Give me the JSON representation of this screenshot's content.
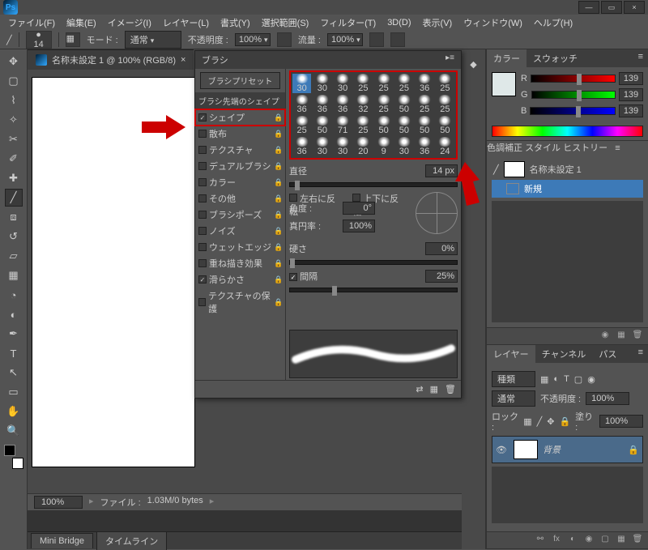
{
  "app": {
    "logo": "Ps"
  },
  "menu": [
    "ファイル(F)",
    "編集(E)",
    "イメージ(I)",
    "レイヤー(L)",
    "書式(Y)",
    "選択範囲(S)",
    "フィルター(T)",
    "3D(D)",
    "表示(V)",
    "ウィンドウ(W)",
    "ヘルプ(H)"
  ],
  "options": {
    "brush_size": "14",
    "mode_label": "モード :",
    "mode_value": "通常",
    "opacity_label": "不透明度 :",
    "opacity_value": "100%",
    "flow_label": "流量 :",
    "flow_value": "100%"
  },
  "document": {
    "tab": "名称未設定 1 @ 100% (RGB/8)",
    "close": "×"
  },
  "status": {
    "zoom": "100%",
    "info_label": "ファイル :",
    "info": "1.03M/0 bytes"
  },
  "bottom_tabs": [
    "Mini Bridge",
    "タイムライン"
  ],
  "color_panel": {
    "tab1": "カラー",
    "tab2": "スウォッチ",
    "r_label": "R",
    "r_value": "139",
    "g_label": "G",
    "g_value": "139",
    "b_label": "B",
    "b_value": "139"
  },
  "history_panel": {
    "tab1": "色調補正",
    "tab2": "スタイル",
    "tab3": "ヒストリー",
    "doc": "名称未設定 1",
    "item": "新規"
  },
  "layers_panel": {
    "tab1": "レイヤー",
    "tab2": "チャンネル",
    "tab3": "パス",
    "kind_label": "種類",
    "blend": "通常",
    "opacity_label": "不透明度 :",
    "opacity_value": "100%",
    "lock_label": "ロック :",
    "fill_label": "塗り :",
    "fill_value": "100%",
    "layer_name": "背景"
  },
  "brush_panel": {
    "title": "ブラシ",
    "preset_btn": "ブラシプリセット",
    "section": "ブラシ先端のシェイプ",
    "opts": [
      {
        "label": "シェイプ",
        "checked": true,
        "lock": true,
        "hilite": true
      },
      {
        "label": "散布",
        "checked": false,
        "lock": true
      },
      {
        "label": "テクスチャ",
        "checked": false,
        "lock": true
      },
      {
        "label": "デュアルブラシ",
        "checked": false,
        "lock": true
      },
      {
        "label": "カラー",
        "checked": false,
        "lock": true
      },
      {
        "label": "その他",
        "checked": false,
        "lock": true
      },
      {
        "label": "ブラシポーズ",
        "checked": false,
        "lock": true
      },
      {
        "label": "ノイズ",
        "checked": false,
        "lock": true
      },
      {
        "label": "ウェットエッジ",
        "checked": false,
        "lock": true
      },
      {
        "label": "重ね描き効果",
        "checked": false,
        "lock": true
      },
      {
        "label": "滑らかさ",
        "checked": true,
        "lock": true
      },
      {
        "label": "テクスチャの保護",
        "checked": false,
        "lock": true
      }
    ],
    "tips": [
      30,
      30,
      30,
      25,
      25,
      25,
      36,
      25,
      36,
      36,
      36,
      32,
      25,
      50,
      25,
      25,
      25,
      50,
      71,
      25,
      50,
      50,
      50,
      50,
      36,
      30,
      30,
      20,
      9,
      30,
      36,
      24
    ],
    "size_label": "直径",
    "size_value": "14 px",
    "flipx": "左右に反転",
    "flipy": "上下に反転",
    "angle_label": "角度 :",
    "angle_value": "0°",
    "round_label": "真円率 :",
    "round_value": "100%",
    "hardness_label": "硬さ",
    "hardness_value": "0%",
    "spacing_label": "間隔",
    "spacing_value": "25%"
  }
}
